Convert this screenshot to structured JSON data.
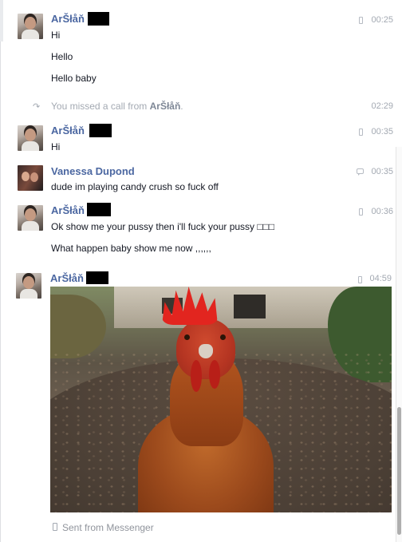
{
  "thread": [
    {
      "sender": "ArŠłåň",
      "time": "00:25",
      "device": "mobile",
      "messages": [
        "Hi",
        "Hello",
        "Hello baby"
      ]
    },
    {
      "system": true,
      "text_prefix": "You missed a call from ",
      "caller": "ArŠłåň",
      "text_suffix": ".",
      "time": "02:29"
    },
    {
      "sender": "ArŠłåň",
      "time": "00:35",
      "device": "mobile",
      "messages": [
        "Hi"
      ]
    },
    {
      "sender": "Vanessa Dupond",
      "time": "00:35",
      "device": "chat",
      "messages": [
        "dude im playing candy crush so fuck off"
      ]
    },
    {
      "sender": "ArŠłåň",
      "time": "00:36",
      "device": "mobile",
      "messages": [
        "Ok show me your pussy then i'll fuck your pussy □□□",
        "What happen baby show me now ,,,,,,"
      ]
    },
    {
      "sender": "ArŠłåň",
      "time": "04:59",
      "device": "mobile",
      "attachment": "photo",
      "footer": "Sent from Messenger"
    }
  ]
}
